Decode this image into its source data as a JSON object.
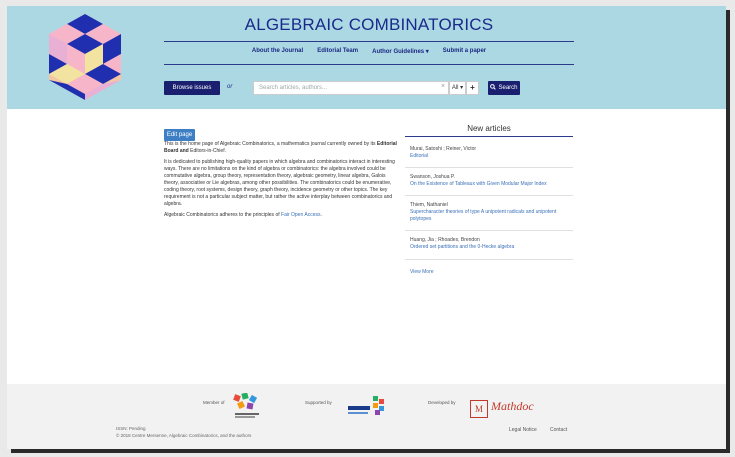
{
  "header": {
    "title": "ALGEBRAIC COMBINATORICS",
    "nav": [
      "About the Journal",
      "Editorial Team",
      "Author Guidelines ▾",
      "Submit a paper"
    ],
    "browse_label": "Browse issues",
    "or_label": "or",
    "search_placeholder": "Search articles, authors...",
    "clear_glyph": "×",
    "filter_label": "All ▾",
    "plus_label": "+",
    "search_button": "Search"
  },
  "main": {
    "edit_button": "Edit page",
    "p1_a": "This is the home page of Algebraic Combinatorics, a mathematics journal currently owned by its ",
    "p1_b": "Editorial Board and",
    "p1_c": " Editors-in-Chief.",
    "p2": "It is dedicated to publishing high-quality papers in which algebra and combinatorics interact in interesting ways. There are no limitations on the kind of algebra or combinatorics: the algebra involved could be commutative algebra, group theory, representation theory, algebraic geometry, linear algebra, Galois theory, associative or Lie algebras, among other possibilities. The combinatorics could be enumerative, coding theory, root systems, design theory, graph theory, incidence geometry or other topics. The key requirement is not a particular subject matter, but rather the active interplay between combinatorics and algebra.",
    "p3_a": "Algebraic Combinatorics adheres to the principles of ",
    "p3_link": "Fair Open Access",
    "p3_b": "."
  },
  "sidebar": {
    "title": "New articles",
    "articles": [
      {
        "authors": "Murai, Satoshi ; Reiner, Victor",
        "title": "Editorial"
      },
      {
        "authors": "Swanson, Joshua P.",
        "title": "On the Existence of Tableaux with Given Modular Major Index"
      },
      {
        "authors": "Thiem, Nathaniel",
        "title": "Supercharacter theories of type A unipotent radicals and unipotent polytopes"
      },
      {
        "authors": "Huang, Jia ; Rhoades, Brendon",
        "title": "Ordered set partitions and the 0-Hecke algebra"
      }
    ],
    "more": "View More"
  },
  "footer": {
    "member_of": "Member of",
    "supported_by": "Supported by",
    "developed_by": "Developed by",
    "mathdoc": "Mathdoc",
    "mathdoc_m": "M",
    "issn": "ISSN: Pending",
    "copyright": "© 2018 Centre Mersenne, Algebraic Combinatorics, and the authors",
    "legal": "Legal Notice",
    "contact": "Contact"
  },
  "colors": {
    "header_bg": "#acd8e4",
    "navy": "#1a1f70",
    "link": "#3a70b8",
    "mathdoc_red": "#c0392b"
  }
}
